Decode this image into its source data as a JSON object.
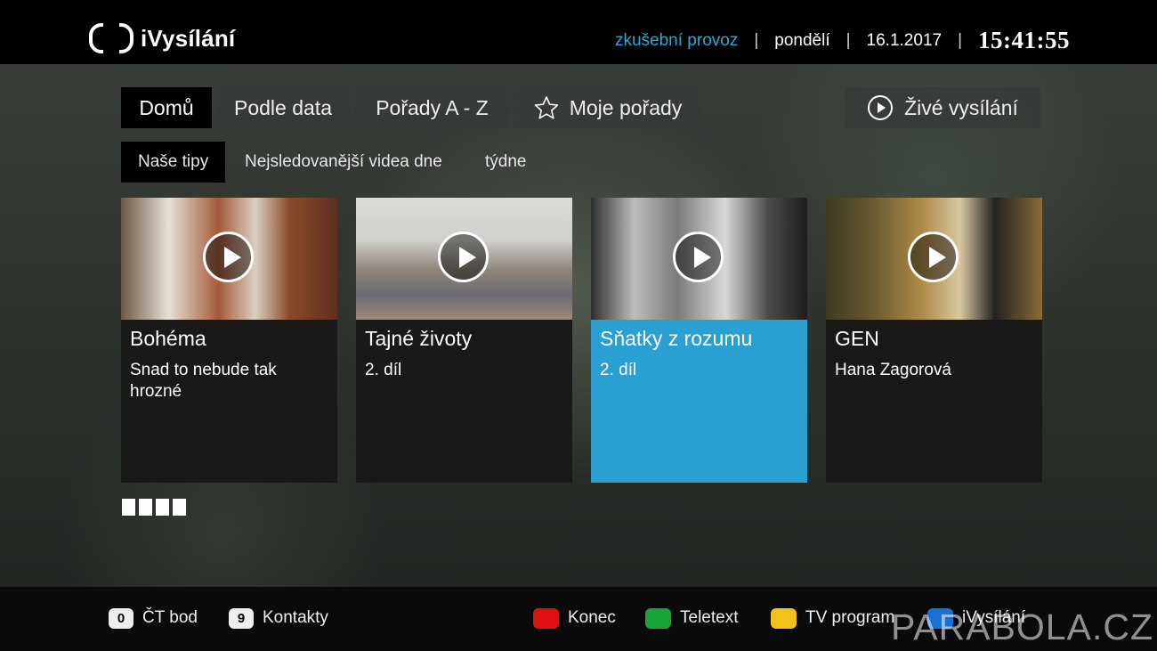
{
  "header": {
    "logo_text": "iVysílání",
    "mode": "zkušební provoz",
    "separator": "|",
    "day": "pondělí",
    "date": "16.1.2017",
    "time": "15:41:55"
  },
  "main_tabs": [
    {
      "label": "Domů",
      "active": true
    },
    {
      "label": "Podle data",
      "active": false
    },
    {
      "label": "Pořady A - Z",
      "active": false
    },
    {
      "label": "Moje pořady",
      "icon": "star-icon",
      "active": false
    },
    {
      "label": "Živé vysílání",
      "icon": "play-circle-icon",
      "active": false
    }
  ],
  "sub_tabs": [
    {
      "label": "Naše tipy",
      "active": true
    },
    {
      "label": "Nejsledovanější videa dne",
      "active": false
    },
    {
      "label": "týdne",
      "active": false
    }
  ],
  "cards": [
    {
      "title": "Bohéma",
      "subtitle": "Snad to nebude tak hrozné",
      "focused": false
    },
    {
      "title": "Tajné životy",
      "subtitle": "2. díl",
      "focused": false
    },
    {
      "title": "Sňatky z rozumu",
      "subtitle": "2. díl",
      "focused": true
    },
    {
      "title": "GEN",
      "subtitle": "Hana Zagorová",
      "focused": false
    }
  ],
  "pager": {
    "pages": 4
  },
  "footer": {
    "num_keys": [
      {
        "key": "0",
        "label": "ČT bod"
      },
      {
        "key": "9",
        "label": "Kontakty"
      }
    ],
    "color_keys": [
      {
        "color": "#e01010",
        "label": "Konec"
      },
      {
        "color": "#18a43a",
        "label": "Teletext"
      },
      {
        "color": "#f2c21b",
        "label": "TV program"
      },
      {
        "color": "#1b6fd6",
        "label": "iVysílání"
      }
    ]
  },
  "watermark": "PARABOLA.CZ",
  "colors": {
    "accent": "#2aa9d7",
    "focus": "#2a9fd1"
  }
}
